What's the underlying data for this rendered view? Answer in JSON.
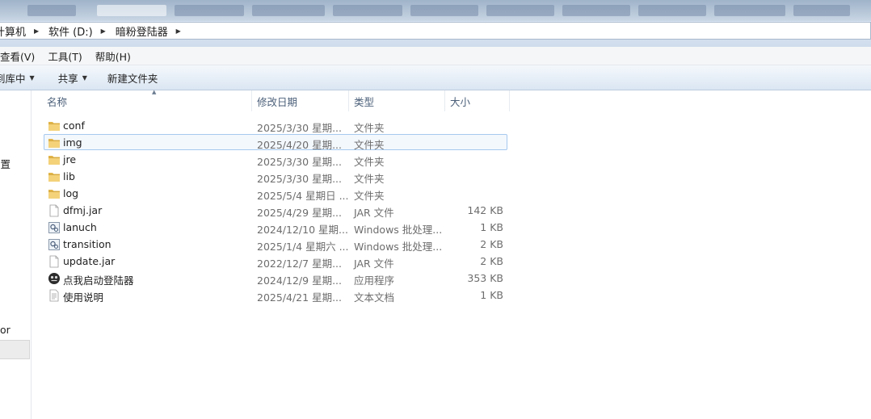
{
  "address_bar": {
    "crumbs": [
      "计算机",
      "软件 (D:)",
      "暗粉登陆器"
    ]
  },
  "menu": {
    "view": "查看(V)",
    "tools": "工具(T)",
    "help": "帮助(H)"
  },
  "toolbar": {
    "include_in_library": "到库中",
    "share": "共享",
    "new_folder": "新建文件夹"
  },
  "nav": {
    "item_settings": "设置",
    "item_or": "or"
  },
  "columns": {
    "name": "名称",
    "date": "修改日期",
    "type": "类型",
    "size": "大小"
  },
  "files": [
    {
      "name": "conf",
      "date": "2025/3/30 星期...",
      "type": "文件夹",
      "size": "",
      "icon": "folder-icon"
    },
    {
      "name": "img",
      "date": "2025/4/20 星期...",
      "type": "文件夹",
      "size": "",
      "icon": "folder-icon"
    },
    {
      "name": "jre",
      "date": "2025/3/30 星期...",
      "type": "文件夹",
      "size": "",
      "icon": "folder-icon"
    },
    {
      "name": "lib",
      "date": "2025/3/30 星期...",
      "type": "文件夹",
      "size": "",
      "icon": "folder-icon"
    },
    {
      "name": "log",
      "date": "2025/5/4 星期日 ...",
      "type": "文件夹",
      "size": "",
      "icon": "folder-icon"
    },
    {
      "name": "dfmj.jar",
      "date": "2025/4/29 星期...",
      "type": "JAR 文件",
      "size": "142 KB",
      "icon": "file-icon"
    },
    {
      "name": "lanuch",
      "date": "2024/12/10 星期...",
      "type": "Windows 批处理...",
      "size": "1 KB",
      "icon": "batch-file-icon"
    },
    {
      "name": "transition",
      "date": "2025/1/4 星期六 ...",
      "type": "Windows 批处理...",
      "size": "2 KB",
      "icon": "batch-file-icon"
    },
    {
      "name": "update.jar",
      "date": "2022/12/7 星期...",
      "type": "JAR 文件",
      "size": "2 KB",
      "icon": "file-icon"
    },
    {
      "name": "点我启动登陆器",
      "date": "2024/12/9 星期...",
      "type": "应用程序",
      "size": "353 KB",
      "icon": "app-icon"
    },
    {
      "name": "使用说明",
      "date": "2025/4/21 星期...",
      "type": "文本文档",
      "size": "1 KB",
      "icon": "text-file-icon"
    }
  ],
  "selected_row": 1,
  "colors": {
    "selection_border": "#a6c9ee",
    "folder": "#e9c25a",
    "column_header_text": "#4c607a"
  }
}
